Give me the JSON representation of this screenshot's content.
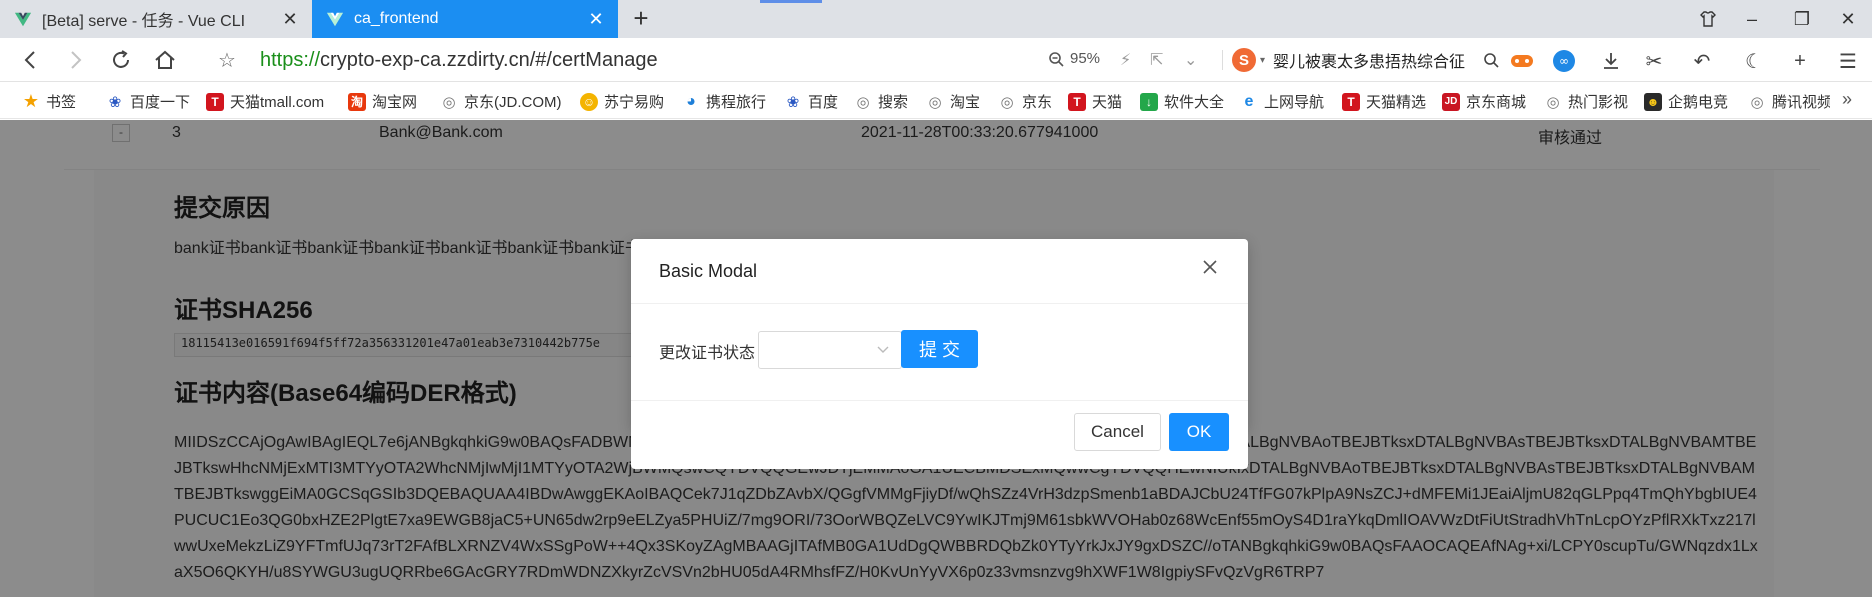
{
  "browser": {
    "tabs": [
      {
        "title": "[Beta] serve - 任务 - Vue CLI",
        "active": false
      },
      {
        "title": "ca_frontend",
        "active": true
      }
    ],
    "url_scheme": "https://",
    "url_rest": "crypto-exp-ca.zzdirty.cn/#/certManage",
    "zoom": "95%",
    "news_ticker": "婴儿被裹太多患捂热综合征",
    "bookmarks_label": "书签",
    "bookmarks": [
      "百度一下",
      "天猫tmall.com",
      "淘宝网",
      "京东(JD.COM)",
      "苏宁易购",
      "携程旅行",
      "百度",
      "搜索",
      "淘宝",
      "京东",
      "天猫",
      "软件大全",
      "上网导航",
      "天猫精选",
      "京东商城",
      "热门影视",
      "企鹅电竞",
      "腾讯视频"
    ]
  },
  "table_row": {
    "expand": "-",
    "id": "3",
    "email": "Bank@Bank.com",
    "time": "2021-11-28T00:33:20.677941000",
    "status": "审核通过"
  },
  "detail": {
    "reason_title": "提交原因",
    "reason_text": "bank证书bank证书bank证书bank证书bank证书bank证书bank证书bank证书",
    "sha_title": "证书SHA256",
    "sha_value": "18115413e016591f694f5ff72a356331201e47a01eab3e7310442b775e",
    "content_title": "证书内容(Base64编码DER格式)",
    "content_text": "MIIDSzCCAjOgAwIBAgIEQL7e6jANBgkqhkiG9w0BAQsFADBWMQswCQYDVQQGEwJDTjEMMAoGA1UECBMDSExMQwwCgYDVQQHEwNIUkIxDTALBgNVBAoTBEJBTksxDTALBgNVBAsTBEJBTksxDTALBgNVBAMTBEJBTkswHhcNMjExMTI3MTYyOTA2WhcNMjIwMjI1MTYyOTA2WjBWMQswCQYDVQQGEwJDTjEMMAoGA1UECBMDSExMQwwCgYDVQQHEwNIUkIxDTALBgNVBAoTBEJBTksxDTALBgNVBAsTBEJBTksxDTALBgNVBAMTBEJBTkswggEiMA0GCSqGSIb3DQEBAQUAA4IBDwAwggEKAoIBAQCek7J1qZDbZAvbX/QGgfVMMgFjiyDf/wQhSZz4VrH3dzpSmenb1aBDAJCbU24TfFG07kPlpA9NsZCJ+dMFEMi1JEaiAljmU82qGLPpq4TmQhYbgbIUE4PUCUC1Eo3QG0bxHZE2PlgtE7xa9EWGB8jaC5+UN65dw2rp9eELZya5PHUiZ/7mg9ORI/73OorWBQZeLVC9YwIKJTmj9M61sbkWVOHab0z68WcEnf55mOyS4D1raYkqDmlIOAVWzDtFiUtStradhVhTnLcpOYzPflRXkTxz217lwwUxeMekzLiZ9YFTmfUJq73rT2FAfBLXRNZV4WxSSgPoW++4Qx3SKoyZAgMBAAGjITAfMB0GA1UdDgQWBBRDQbZk0YTyYrkJxJY9gxDSZC//oTANBgkqhkiG9w0BAQsFAAOCAQEAfNAg+xi/LCPY0scupTu/GWNqzdx1LxaX5O6QKYH/u8SYWGU3ugUQRRbe6GAcGRY7RDmWDNZXkyrZcVSVn2bHU05dA4RMhsfFZ/H0KvUnYyVX6p0z33vmsnzvg9hXWF1W8IgpiySFvQzVgR6TRP7"
  },
  "modal": {
    "title": "Basic Modal",
    "field_label": "更改证书状态",
    "select_value": "",
    "submit_label": "提 交",
    "cancel_label": "Cancel",
    "ok_label": "OK"
  },
  "colors": {
    "primary": "#1890ff",
    "tab_active": "#1b8ef2",
    "url_scheme": "#1a8f1a",
    "mask": "rgba(0,0,0,0.45)"
  }
}
